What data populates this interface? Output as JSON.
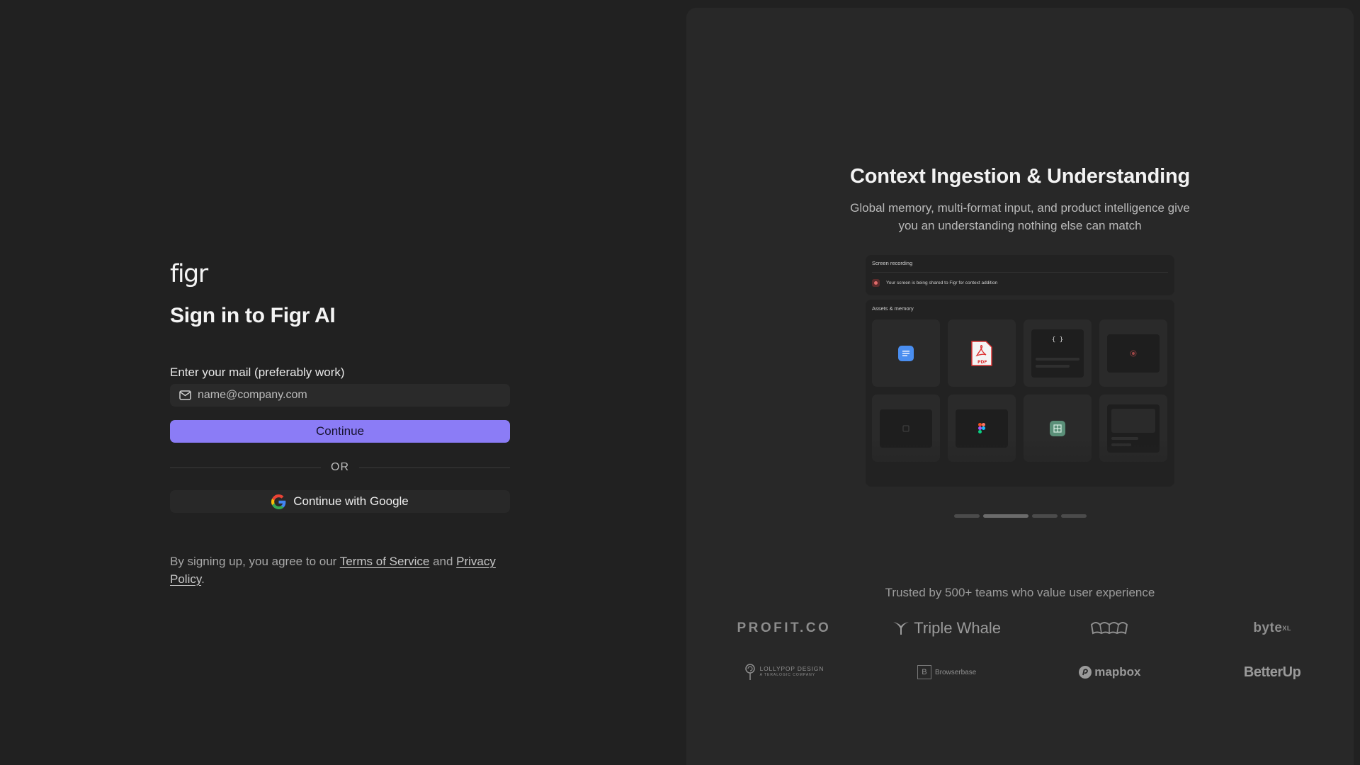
{
  "left": {
    "logo": "figr",
    "title": "Sign in to Figr AI",
    "email_label": "Enter your mail (preferably work)",
    "email_placeholder": "name@company.com",
    "email_value": "",
    "continue_label": "Continue",
    "or_label": "OR",
    "google_label": "Continue with Google",
    "legal": {
      "prefix": "By signing up, you agree to our ",
      "terms": "Terms of Service",
      "and": " and ",
      "privacy": "Privacy Policy",
      "suffix": "."
    }
  },
  "right": {
    "title": "Context Ingestion & Understanding",
    "subtitle": "Global memory, multi-format input, and product intelligence give you an understanding nothing else can match",
    "mockup": {
      "recording_title": "Screen recording",
      "recording_text": "Your screen is being shared to Figr for context addition",
      "assets_title": "Assets & memory",
      "pdf_label": "PDF",
      "code_label": "{ }"
    },
    "carousel": {
      "count": 4,
      "active_index": 1
    },
    "trusted_text": "Trusted by 500+ teams who value user experience",
    "logos_row1": [
      "PROFIT.CO",
      "Triple Whale",
      "",
      "byte"
    ],
    "logos_row1_extra": {
      "byte_sup": "XL"
    },
    "logos_row2": [
      "LOLLYPOP DESIGN",
      "Browserbase",
      "mapbox",
      "BetterUp"
    ],
    "lollypop_sub": "A TERALOGIC COMPANY",
    "browserbase_mark": "B"
  },
  "colors": {
    "background": "#212121",
    "panel": "#282828",
    "accent": "#8b7cf6"
  }
}
